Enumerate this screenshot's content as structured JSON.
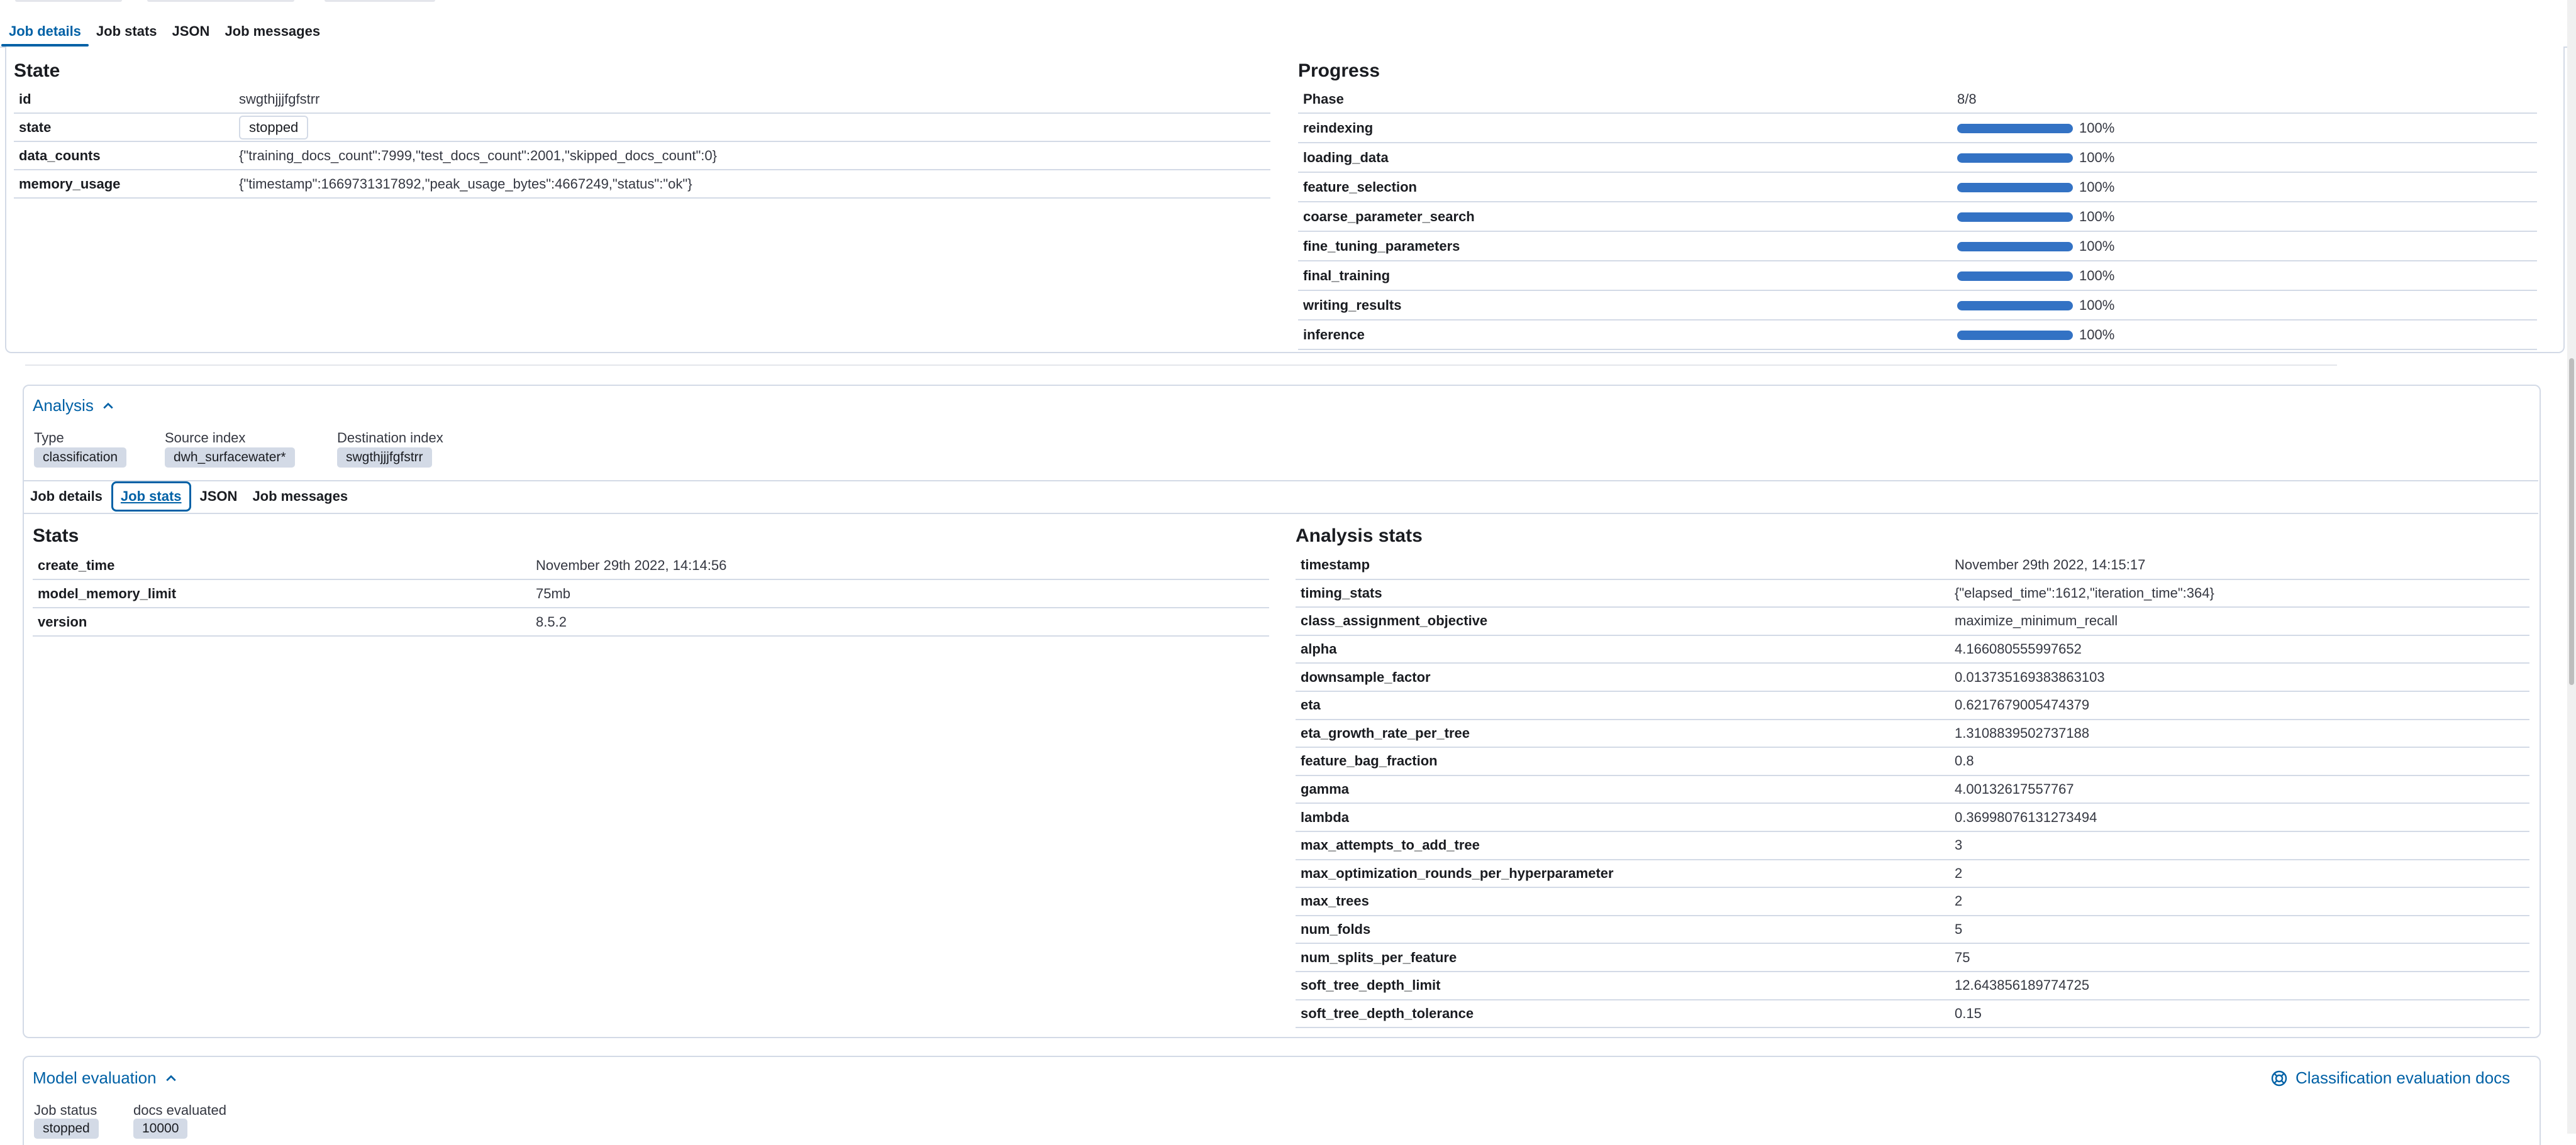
{
  "top_tabs": [
    {
      "label": "Job details",
      "selected": true
    },
    {
      "label": "Job stats",
      "selected": false
    },
    {
      "label": "JSON",
      "selected": false
    },
    {
      "label": "Job messages",
      "selected": false
    }
  ],
  "state_section": {
    "title": "State",
    "rows": [
      {
        "key": "id",
        "value": "swgthjjjfgfstrr"
      },
      {
        "key": "state",
        "value": "stopped"
      },
      {
        "key": "data_counts",
        "value": "{\"training_docs_count\":7999,\"test_docs_count\":2001,\"skipped_docs_count\":0}"
      },
      {
        "key": "memory_usage",
        "value": "{\"timestamp\":1669731317892,\"peak_usage_bytes\":4667249,\"status\":\"ok\"}"
      }
    ]
  },
  "progress_section": {
    "title": "Progress",
    "phase_label": "Phase",
    "phase_value": "8/8",
    "phases": [
      {
        "name": "reindexing",
        "percent": 100,
        "label": "100%"
      },
      {
        "name": "loading_data",
        "percent": 100,
        "label": "100%"
      },
      {
        "name": "feature_selection",
        "percent": 100,
        "label": "100%"
      },
      {
        "name": "coarse_parameter_search",
        "percent": 100,
        "label": "100%"
      },
      {
        "name": "fine_tuning_parameters",
        "percent": 100,
        "label": "100%"
      },
      {
        "name": "final_training",
        "percent": 100,
        "label": "100%"
      },
      {
        "name": "writing_results",
        "percent": 100,
        "label": "100%"
      },
      {
        "name": "inference",
        "percent": 100,
        "label": "100%"
      }
    ]
  },
  "analysis": {
    "title": "Analysis",
    "type_label": "Type",
    "type_value": "classification",
    "source_label": "Source index",
    "source_value": "dwh_surfacewater*",
    "dest_label": "Destination index",
    "dest_value": "swgthjjjfgfstrr",
    "tabs": [
      {
        "label": "Job details",
        "selected": false
      },
      {
        "label": "Job stats",
        "selected": true
      },
      {
        "label": "JSON",
        "selected": false
      },
      {
        "label": "Job messages",
        "selected": false
      }
    ]
  },
  "stats_section": {
    "title": "Stats",
    "rows": [
      {
        "key": "create_time",
        "value": "November 29th 2022, 14:14:56"
      },
      {
        "key": "model_memory_limit",
        "value": "75mb"
      },
      {
        "key": "version",
        "value": "8.5.2"
      }
    ]
  },
  "analysis_stats_section": {
    "title": "Analysis stats",
    "rows": [
      {
        "key": "timestamp",
        "value": "November 29th 2022, 14:15:17"
      },
      {
        "key": "timing_stats",
        "value": "{\"elapsed_time\":1612,\"iteration_time\":364}"
      },
      {
        "key": "class_assignment_objective",
        "value": "maximize_minimum_recall"
      },
      {
        "key": "alpha",
        "value": "4.166080555997652"
      },
      {
        "key": "downsample_factor",
        "value": "0.013735169383863103"
      },
      {
        "key": "eta",
        "value": "0.6217679005474379"
      },
      {
        "key": "eta_growth_rate_per_tree",
        "value": "1.3108839502737188"
      },
      {
        "key": "feature_bag_fraction",
        "value": "0.8"
      },
      {
        "key": "gamma",
        "value": "4.00132617557767"
      },
      {
        "key": "lambda",
        "value": "0.36998076131273494"
      },
      {
        "key": "max_attempts_to_add_tree",
        "value": "3"
      },
      {
        "key": "max_optimization_rounds_per_hyperparameter",
        "value": "2"
      },
      {
        "key": "max_trees",
        "value": "2"
      },
      {
        "key": "num_folds",
        "value": "5"
      },
      {
        "key": "num_splits_per_feature",
        "value": "75"
      },
      {
        "key": "soft_tree_depth_limit",
        "value": "12.643856189774725"
      },
      {
        "key": "soft_tree_depth_tolerance",
        "value": "0.15"
      }
    ]
  },
  "model_evaluation": {
    "title": "Model evaluation",
    "docs_link": "Classification evaluation docs",
    "job_status_label": "Job status",
    "job_status_value": "stopped",
    "docs_evaluated_label": "docs evaluated",
    "docs_evaluated_value": "10000"
  },
  "colors": {
    "accent": "#0061a6",
    "progress": "#3372c4",
    "border": "#d3dae6"
  }
}
